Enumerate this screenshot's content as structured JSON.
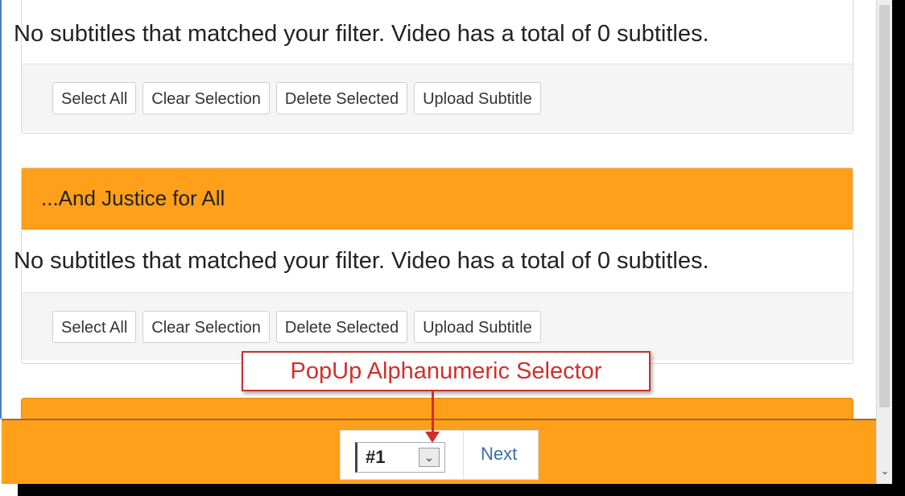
{
  "sections": [
    {
      "message": "No subtitles that matched your filter. Video has a total of 0 subtitles.",
      "buttons": [
        "Select All",
        "Clear Selection",
        "Delete Selected",
        "Upload Subtitle"
      ]
    },
    {
      "title": "...And Justice for All",
      "message": "No subtitles that matched your filter. Video has a total of 0 subtitles.",
      "buttons": [
        "Select All",
        "Clear Selection",
        "Delete Selected",
        "Upload Subtitle"
      ]
    }
  ],
  "pager": {
    "selected": "#1",
    "next_label": "Next"
  },
  "annotation": {
    "callout_text": "PopUp Alphanumeric Selector"
  },
  "icons": {
    "dropdown": "chevron-down-icon",
    "scroll_down": "scroll-down-arrow-icon"
  },
  "colors": {
    "heading_orange": "#ff9f1a",
    "callout_red": "#d0302b",
    "link_blue": "#3a6da8"
  }
}
